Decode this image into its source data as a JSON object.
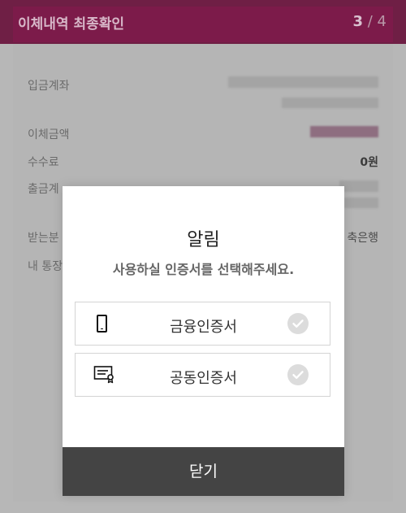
{
  "header": {
    "title": "이체내역 최종확인",
    "step_current": "3",
    "step_sep": " / ",
    "step_total": "4"
  },
  "details": {
    "deposit_account_label": "입금계좌",
    "transfer_amount_label": "이체금액",
    "fee_label": "수수료",
    "fee_value": "0원",
    "withdrawal_account_label": "출금계",
    "recipient_label": "받는분",
    "recipient_bank": "축은행",
    "my_account_label": "내 통장"
  },
  "modal": {
    "title": "알림",
    "subtitle": "사용하실 인증서를 선택해주세요.",
    "options": [
      {
        "label": "금융인증서",
        "icon": "phone-icon"
      },
      {
        "label": "공동인증서",
        "icon": "certificate-icon"
      }
    ],
    "close_label": "닫기"
  },
  "colors": {
    "header_bg": "#7c1b4a",
    "close_button_bg": "#444444",
    "modal_bg": "#ffffff",
    "check_circle": "#dcdcdc"
  }
}
